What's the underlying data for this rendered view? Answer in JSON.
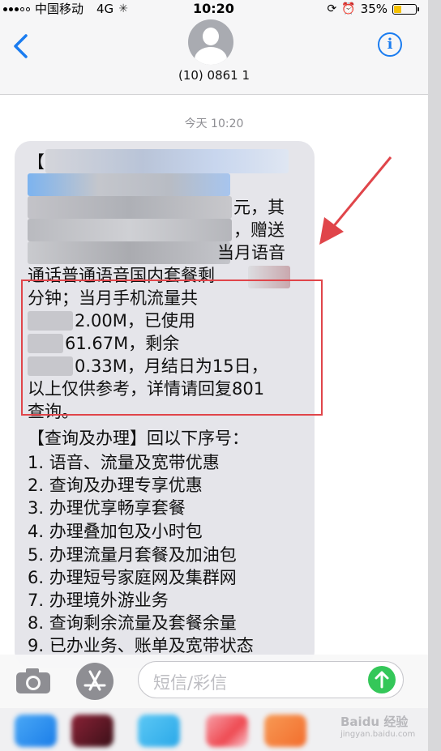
{
  "status_bar": {
    "carrier": "中国移动",
    "network": "4G",
    "time": "10:20",
    "battery": "35%"
  },
  "header": {
    "contact": "(10) 0861 1",
    "back_icon": "chevron-left-icon",
    "info_icon": "info-icon"
  },
  "timestamp": "今天 10:20",
  "message": {
    "lines": [
      "【",
      "",
      "元，其",
      "，赠送",
      "当月语音",
      "通话普通语音国内套餐剩",
      "分钟；当月手机流量共",
      "2.00M，已使用",
      "61.67M，剩余",
      "0.33M，月结日为15日，",
      "以上仅供参考，详情请回复801",
      "查询。",
      "【查询及办理】回以下序号：",
      "1. 语音、流量及宽带优惠",
      "2. 查询及办理专享优惠",
      "3. 办理优享畅享套餐",
      "4. 办理叠加包及小时包",
      "5. 办理流量月套餐及加油包",
      "6. 办理短号家庭网及集群网",
      "7. 办理境外游业务",
      "8. 查询剩余流量及套餐余量",
      "9. 已办业务、账单及宽带状态"
    ]
  },
  "input": {
    "placeholder": "短信/彩信"
  },
  "watermark": {
    "brand": "Baidu 经验",
    "sub": "jingyan.baidu.com"
  },
  "colors": {
    "accent": "#1a7cf0",
    "bubble": "#e5e5ea",
    "highlight": "#e0454a",
    "send": "#34c759"
  }
}
